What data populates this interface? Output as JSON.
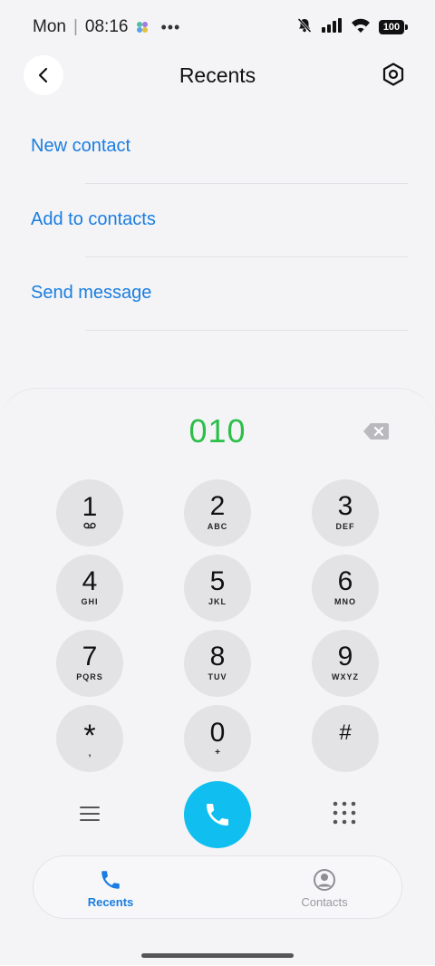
{
  "status_bar": {
    "day": "Mon",
    "time": "08:16",
    "dots": "•••",
    "battery": "100"
  },
  "header": {
    "title": "Recents"
  },
  "actions": [
    {
      "label": "New contact"
    },
    {
      "label": "Add to contacts"
    },
    {
      "label": "Send message"
    }
  ],
  "dialer": {
    "number": "010",
    "keys": [
      {
        "digit": "1",
        "letters": "",
        "icon": "voicemail-icon"
      },
      {
        "digit": "2",
        "letters": "ABC"
      },
      {
        "digit": "3",
        "letters": "DEF"
      },
      {
        "digit": "4",
        "letters": "GHI"
      },
      {
        "digit": "5",
        "letters": "JKL"
      },
      {
        "digit": "6",
        "letters": "MNO"
      },
      {
        "digit": "7",
        "letters": "PQRS"
      },
      {
        "digit": "8",
        "letters": "TUV"
      },
      {
        "digit": "9",
        "letters": "WXYZ"
      },
      {
        "digit": "*",
        "letters": ","
      },
      {
        "digit": "0",
        "letters": "+"
      },
      {
        "digit": "#",
        "letters": ""
      }
    ]
  },
  "nav": {
    "recents_label": "Recents",
    "contacts_label": "Contacts"
  },
  "colors": {
    "accent": "#1a7de0",
    "number": "#2bbf4a",
    "call": "#10bff0",
    "key_bg": "#e3e3e5"
  }
}
